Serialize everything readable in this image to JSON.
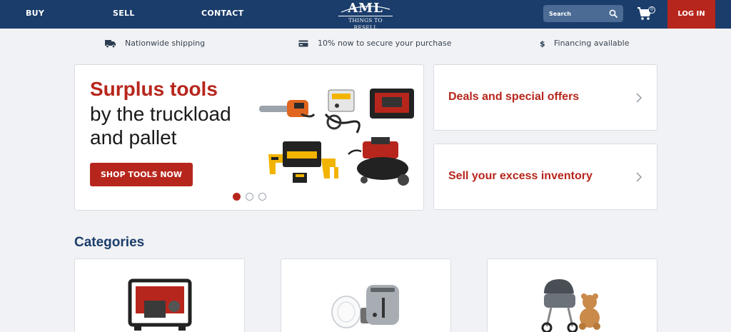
{
  "nav": {
    "buy": "BUY",
    "sell": "SELL",
    "contact": "CONTACT",
    "logo_main": "AML",
    "logo_sub": "THINGS TO RESELL",
    "search_placeholder": "Search",
    "cart_count": "0",
    "login": "LOG IN"
  },
  "benefits": [
    {
      "icon": "truck-icon",
      "text": "Nationwide shipping"
    },
    {
      "icon": "credit-card-icon",
      "text": "10% now to secure your purchase"
    },
    {
      "icon": "dollar-icon",
      "text": "Financing available"
    }
  ],
  "hero": {
    "title_red": "Surplus tools",
    "title_line2": "by the truckload",
    "title_line3": "and pallet",
    "cta": "SHOP TOOLS NOW",
    "slides": 3,
    "active_slide": 1
  },
  "promos": [
    {
      "label": "Deals and special offers"
    },
    {
      "label": "Sell your excess inventory"
    }
  ],
  "categories": {
    "heading": "Categories"
  },
  "colors": {
    "nav_bg": "#1b3d6b",
    "accent_red": "#b7261c",
    "page_bg": "#f1f2f5"
  }
}
